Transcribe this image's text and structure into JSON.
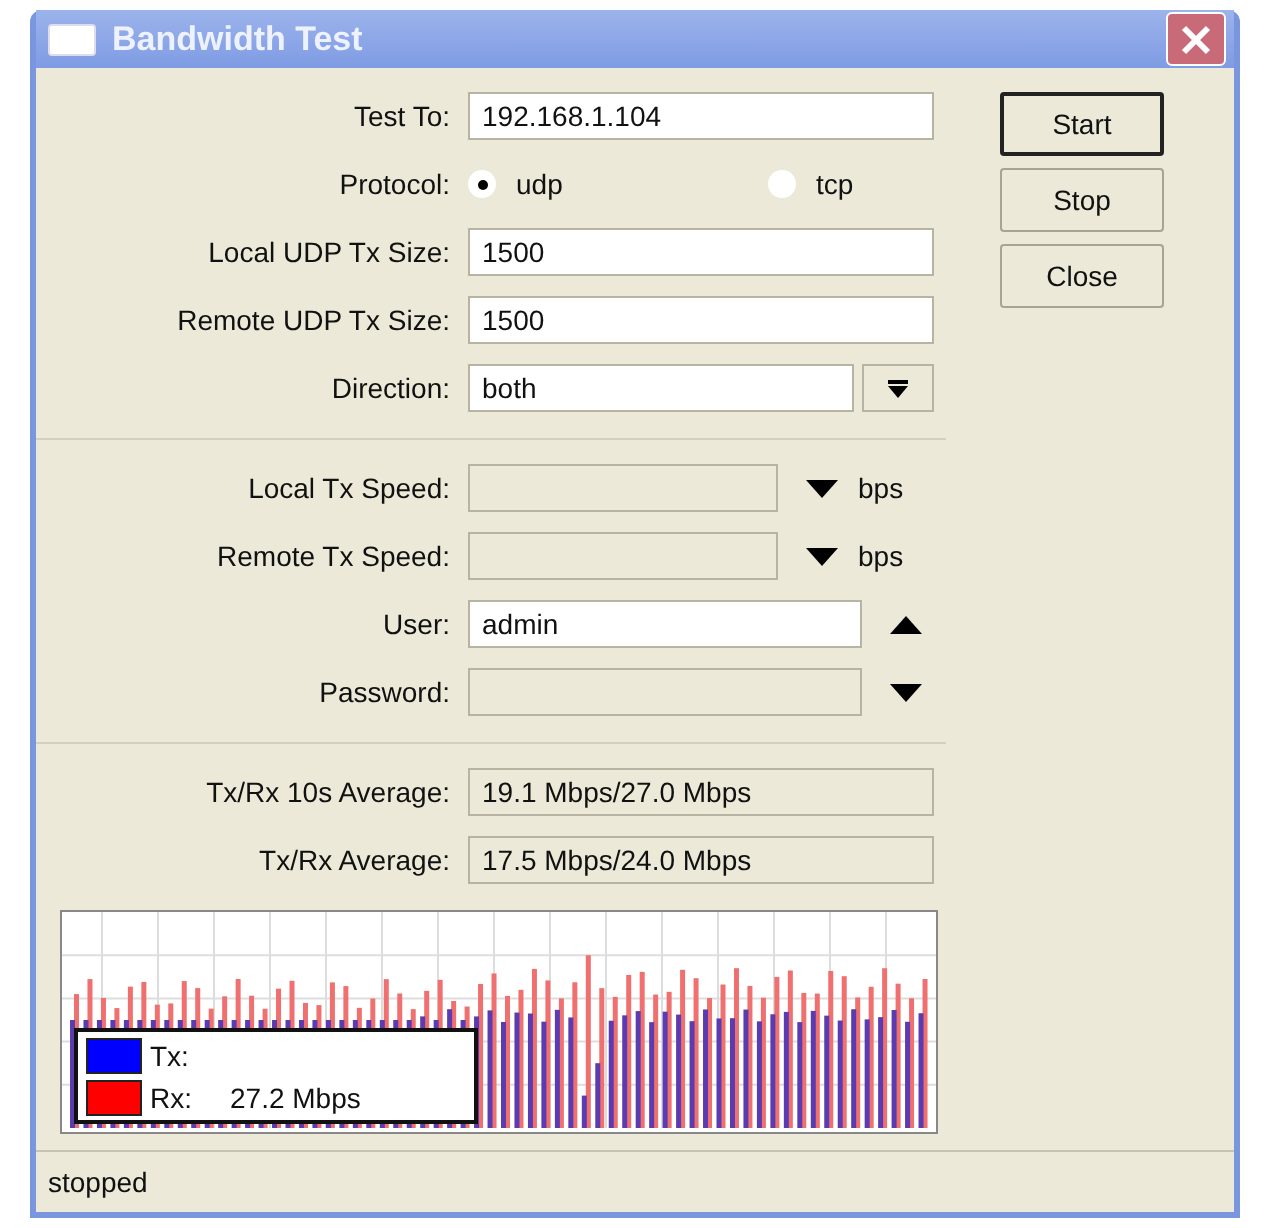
{
  "window": {
    "title": "Bandwidth Test"
  },
  "sections": [
    [
      {
        "kind": "text",
        "label": "Test To:",
        "value": "192.168.1.104"
      },
      {
        "kind": "radio",
        "label": "Protocol:",
        "options": [
          {
            "label": "udp",
            "selected": true
          },
          {
            "label": "tcp",
            "selected": false
          }
        ]
      },
      {
        "kind": "text",
        "label": "Local UDP Tx Size:",
        "value": "1500"
      },
      {
        "kind": "text",
        "label": "Remote UDP Tx Size:",
        "value": "1500"
      },
      {
        "kind": "combo",
        "label": "Direction:",
        "value": "both"
      }
    ],
    [
      {
        "kind": "optional",
        "label": "Local Tx Speed:",
        "disabled": true,
        "expanded": false,
        "unit": "bps"
      },
      {
        "kind": "optional",
        "label": "Remote Tx Speed:",
        "disabled": true,
        "expanded": false,
        "unit": "bps"
      },
      {
        "kind": "optional",
        "label": "User:",
        "value": "admin",
        "disabled": false,
        "expanded": true
      },
      {
        "kind": "optional",
        "label": "Password:",
        "disabled": true,
        "expanded": false
      }
    ],
    [
      {
        "kind": "readonly",
        "label": "Tx/Rx 10s Average:",
        "value": "19.1 Mbps/27.0 Mbps"
      },
      {
        "kind": "readonly",
        "label": "Tx/Rx Average:",
        "value": "17.5 Mbps/24.0 Mbps"
      }
    ]
  ],
  "buttons": [
    {
      "label": "Start",
      "default": true
    },
    {
      "label": "Stop",
      "default": false
    },
    {
      "label": "Close",
      "default": false
    }
  ],
  "legend": [
    {
      "label": "Tx:",
      "color": "#0000ff"
    },
    {
      "label": "Rx:",
      "color": "#ff0000",
      "reading": "27.2 Mbps"
    }
  ],
  "status_bar": "stopped"
}
